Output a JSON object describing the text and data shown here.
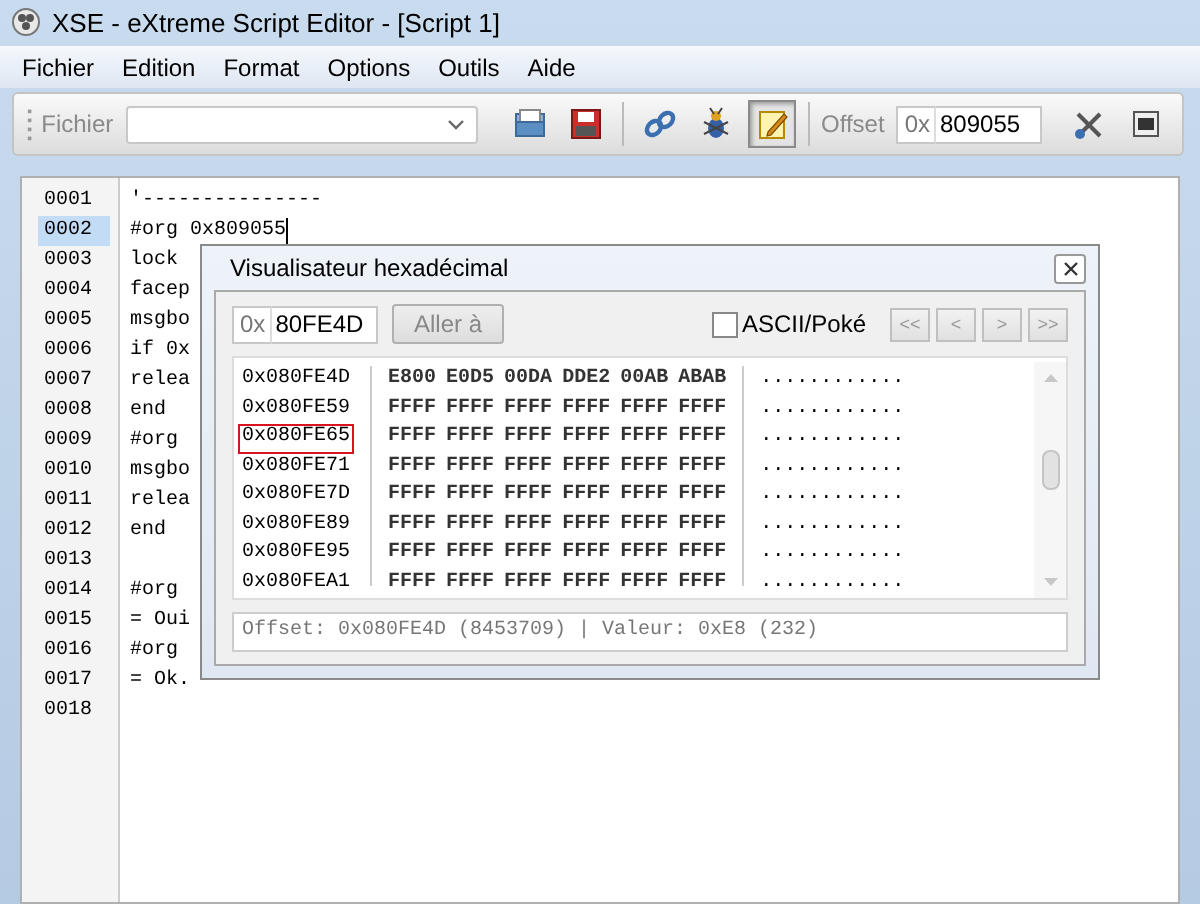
{
  "window": {
    "title": "XSE - eXtreme Script Editor - [Script 1]"
  },
  "menu": [
    "Fichier",
    "Edition",
    "Format",
    "Options",
    "Outils",
    "Aide"
  ],
  "toolbar": {
    "file_label": "Fichier",
    "offset_label": "Offset",
    "offset_prefix": "0x",
    "offset_value": "809055",
    "notes_pressed": true
  },
  "editor": {
    "lines": [
      {
        "number": "0001",
        "text": "'---------------",
        "selected": false
      },
      {
        "number": "0002",
        "text": "#org 0x809055",
        "selected": true
      },
      {
        "number": "0003",
        "text": "lock",
        "selected": false
      },
      {
        "number": "0004",
        "text": "facep",
        "selected": false
      },
      {
        "number": "0005",
        "text": "msgbo",
        "selected": false
      },
      {
        "number": "0006",
        "text": "if 0x",
        "selected": false
      },
      {
        "number": "0007",
        "text": "relea",
        "selected": false
      },
      {
        "number": "0008",
        "text": "end",
        "selected": false
      },
      {
        "number": "0009",
        "text": "#org",
        "selected": false
      },
      {
        "number": "0010",
        "text": "msgbo",
        "selected": false
      },
      {
        "number": "0011",
        "text": "relea",
        "selected": false
      },
      {
        "number": "0012",
        "text": "end",
        "selected": false
      },
      {
        "number": "0013",
        "selected": false
      },
      {
        "number": "0014",
        "text": "#org",
        "selected": false
      },
      {
        "number": "0015",
        "text": "= Oui",
        "selected": false
      },
      {
        "number": "0016",
        "text": "#org",
        "selected": false
      },
      {
        "number": "0017",
        "text": "= Ok.",
        "selected": false
      },
      {
        "number": "0018",
        "selected": false
      }
    ]
  },
  "hex_viewer": {
    "title": "Visualisateur hexadécimal",
    "address_prefix": "0x",
    "address_value": "80FE4D",
    "go_button": "Aller à",
    "ascii_checkbox": {
      "label": "ASCII/Poké",
      "checked": false
    },
    "nav_buttons": [
      "<<",
      "<",
      ">",
      ">>"
    ],
    "rows": [
      {
        "address": "0x080FE4D",
        "words": [
          "E800",
          "E0D5",
          "00DA",
          "DDE2",
          "00AB",
          "ABAB"
        ],
        "ascii": "............",
        "highlighted": false
      },
      {
        "address": "0x080FE59",
        "words": [
          "FFFF",
          "FFFF",
          "FFFF",
          "FFFF",
          "FFFF",
          "FFFF"
        ],
        "ascii": "............",
        "highlighted": false
      },
      {
        "address": "0x080FE65",
        "words": [
          "FFFF",
          "FFFF",
          "FFFF",
          "FFFF",
          "FFFF",
          "FFFF"
        ],
        "ascii": "............",
        "highlighted": true
      },
      {
        "address": "0x080FE71",
        "words": [
          "FFFF",
          "FFFF",
          "FFFF",
          "FFFF",
          "FFFF",
          "FFFF"
        ],
        "ascii": "............",
        "highlighted": false
      },
      {
        "address": "0x080FE7D",
        "words": [
          "FFFF",
          "FFFF",
          "FFFF",
          "FFFF",
          "FFFF",
          "FFFF"
        ],
        "ascii": "............",
        "highlighted": false
      },
      {
        "address": "0x080FE89",
        "words": [
          "FFFF",
          "FFFF",
          "FFFF",
          "FFFF",
          "FFFF",
          "FFFF"
        ],
        "ascii": "............",
        "highlighted": false
      },
      {
        "address": "0x080FE95",
        "words": [
          "FFFF",
          "FFFF",
          "FFFF",
          "FFFF",
          "FFFF",
          "FFFF"
        ],
        "ascii": "............",
        "highlighted": false
      },
      {
        "address": "0x080FEA1",
        "words": [
          "FFFF",
          "FFFF",
          "FFFF",
          "FFFF",
          "FFFF",
          "FFFF"
        ],
        "ascii": "............",
        "highlighted": false
      }
    ],
    "status": "Offset: 0x080FE4D (8453709) | Valeur: 0xE8 (232)"
  }
}
